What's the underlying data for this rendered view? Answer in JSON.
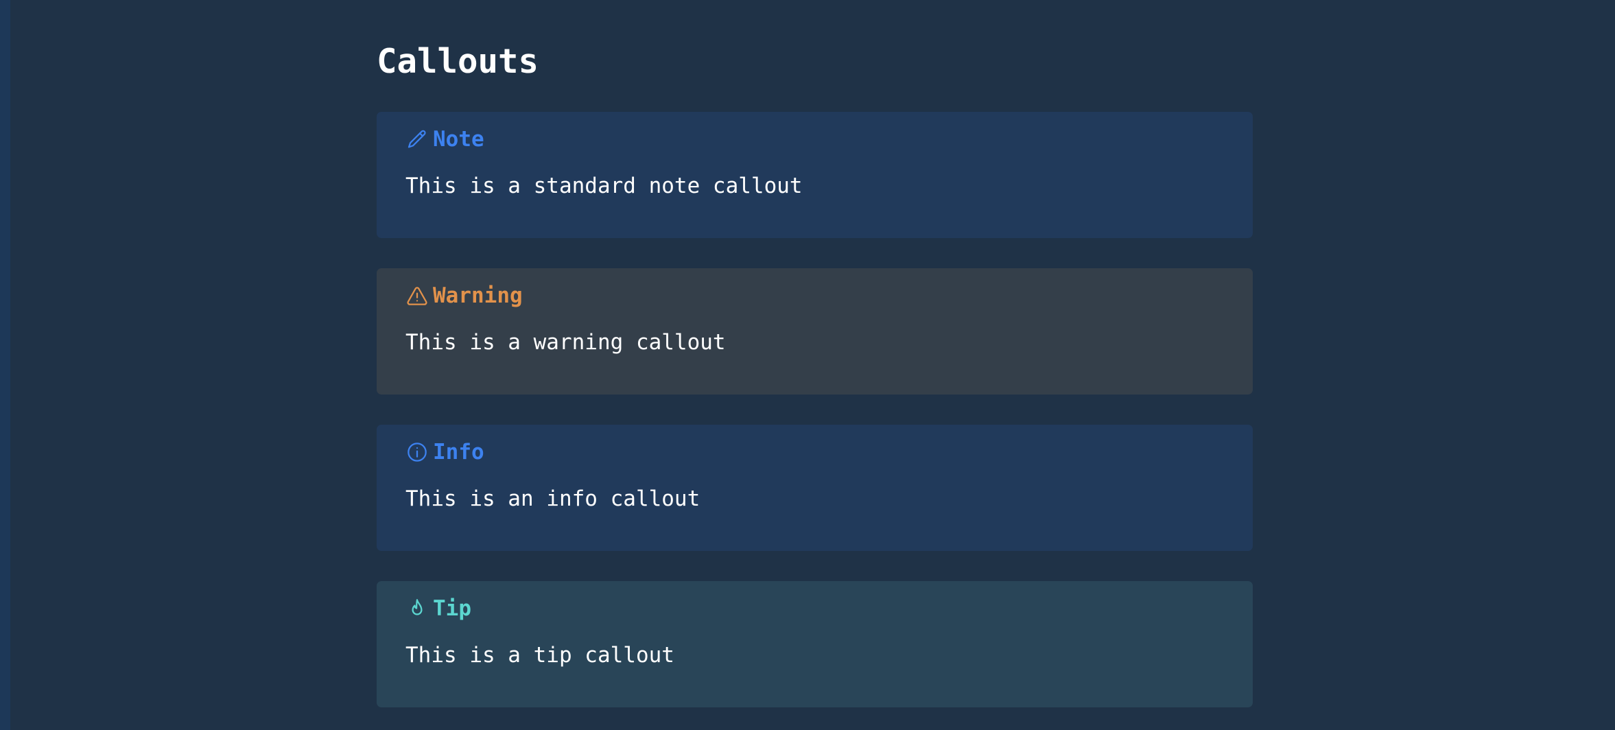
{
  "page": {
    "title": "Callouts"
  },
  "callouts": [
    {
      "type": "note",
      "title": "Note",
      "icon": "pencil-icon",
      "body": "This is a standard note callout",
      "accent_color": "#3d82f0",
      "background_color": "#213a5b"
    },
    {
      "type": "warning",
      "title": "Warning",
      "icon": "warning-triangle-icon",
      "body": "This is a warning callout",
      "accent_color": "#e2924b",
      "background_color": "#343f4a"
    },
    {
      "type": "info",
      "title": "Info",
      "icon": "info-circle-icon",
      "body": "This is an info callout",
      "accent_color": "#3d82f0",
      "background_color": "#213a5b"
    },
    {
      "type": "tip",
      "title": "Tip",
      "icon": "flame-icon",
      "body": "This is a tip callout",
      "accent_color": "#5cd6d0",
      "background_color": "#294558"
    }
  ],
  "colors": {
    "page_background": "#1f3247",
    "text": "#ffffff"
  }
}
